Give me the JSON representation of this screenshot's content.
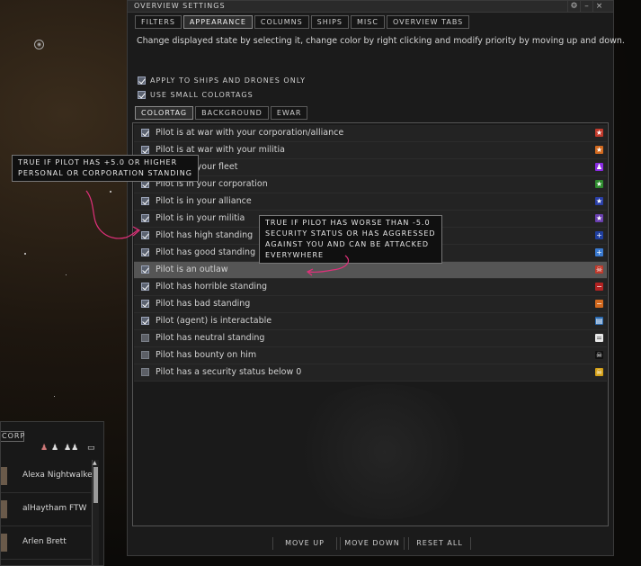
{
  "window": {
    "title": "OVERVIEW SETTINGS",
    "tabs": [
      "FILTERS",
      "APPEARANCE",
      "COLUMNS",
      "SHIPS",
      "MISC",
      "OVERVIEW TABS"
    ],
    "active_tab": "APPEARANCE",
    "description": "Change displayed state by selecting it, change color by right clicking and modify priority by moving up and down.",
    "options": [
      {
        "label": "APPLY TO SHIPS AND DRONES ONLY",
        "checked": true
      },
      {
        "label": "USE SMALL COLORTAGS",
        "checked": true
      }
    ],
    "subtabs": [
      "COLORTAG",
      "BACKGROUND",
      "EWAR"
    ],
    "active_subtab": "COLORTAG",
    "rows": [
      {
        "label": "Pilot is at war with your corporation/alliance",
        "checked": true,
        "tag_color": "#c0392b",
        "tag_icon": "star-icon",
        "tag_glyph": "★"
      },
      {
        "label": "Pilot is at war with your militia",
        "checked": true,
        "tag_color": "#d2691e",
        "tag_icon": "star-icon",
        "tag_glyph": "★"
      },
      {
        "label": "Pilot is in your fleet",
        "checked": true,
        "tag_color": "#8a2be2",
        "tag_icon": "person-icon",
        "tag_glyph": "♟"
      },
      {
        "label": "Pilot is in your corporation",
        "checked": true,
        "tag_color": "#2e8b2e",
        "tag_icon": "star-icon",
        "tag_glyph": "★"
      },
      {
        "label": "Pilot is in your alliance",
        "checked": true,
        "tag_color": "#2a3fa8",
        "tag_icon": "star-icon",
        "tag_glyph": "★"
      },
      {
        "label": "Pilot is in your militia",
        "checked": true,
        "tag_color": "#6a3fb0",
        "tag_icon": "star-icon",
        "tag_glyph": "★"
      },
      {
        "label": "Pilot has high standing",
        "checked": true,
        "tag_color": "#1f3fa0",
        "tag_icon": "plus-icon",
        "tag_glyph": "+"
      },
      {
        "label": "Pilot has good standing",
        "checked": true,
        "tag_color": "#3a7ad0",
        "tag_icon": "plus-icon",
        "tag_glyph": "+"
      },
      {
        "label": "Pilot is an outlaw",
        "checked": true,
        "tag_color": "#c0392b",
        "tag_icon": "skull-icon",
        "tag_glyph": "☠",
        "selected": true
      },
      {
        "label": "Pilot has horrible standing",
        "checked": true,
        "tag_color": "#b22222",
        "tag_icon": "minus-icon",
        "tag_glyph": "−"
      },
      {
        "label": "Pilot has bad standing",
        "checked": true,
        "tag_color": "#d2691e",
        "tag_icon": "minus-icon",
        "tag_glyph": "−"
      },
      {
        "label": "Pilot (agent) is interactable",
        "checked": true,
        "tag_color": "#2a6ab0",
        "tag_icon": "chat-bubble-icon",
        "tag_glyph": "▤"
      },
      {
        "label": "Pilot has neutral standing",
        "checked": false,
        "tag_color": "#e8e8e8",
        "tag_icon": "equals-icon",
        "tag_glyph": "="
      },
      {
        "label": "Pilot has bounty on him",
        "checked": false,
        "tag_color": "#111111",
        "tag_icon": "skull-icon",
        "tag_glyph": "☠"
      },
      {
        "label": "Pilot has a security status below 0",
        "checked": false,
        "tag_color": "#d4a017",
        "tag_icon": "skull-icon",
        "tag_glyph": "☠"
      }
    ],
    "buttons": {
      "move_up": "MOVE UP",
      "move_down": "MOVE DOWN",
      "reset_all": "RESET ALL"
    }
  },
  "tooltips": {
    "high_standing": [
      "TRUE IF PILOT HAS +5.0 OR HIGHER",
      "PERSONAL OR CORPORATION STANDING"
    ],
    "outlaw": [
      "TRUE IF PILOT HAS WORSE THAN -5.0",
      "SECURITY STATUS OR HAS AGGRESSED",
      "AGAINST YOU AND CAN BE ATTACKED",
      "EVERYWHERE"
    ]
  },
  "chat": {
    "header": "CORP",
    "members": [
      "Alexa Nightwalke",
      "alHaytham FTW",
      "Arlen Brett"
    ]
  },
  "colors": {
    "annotation": "#e0307a",
    "panel": "#1b1b1b",
    "selected_row": "#555555"
  }
}
